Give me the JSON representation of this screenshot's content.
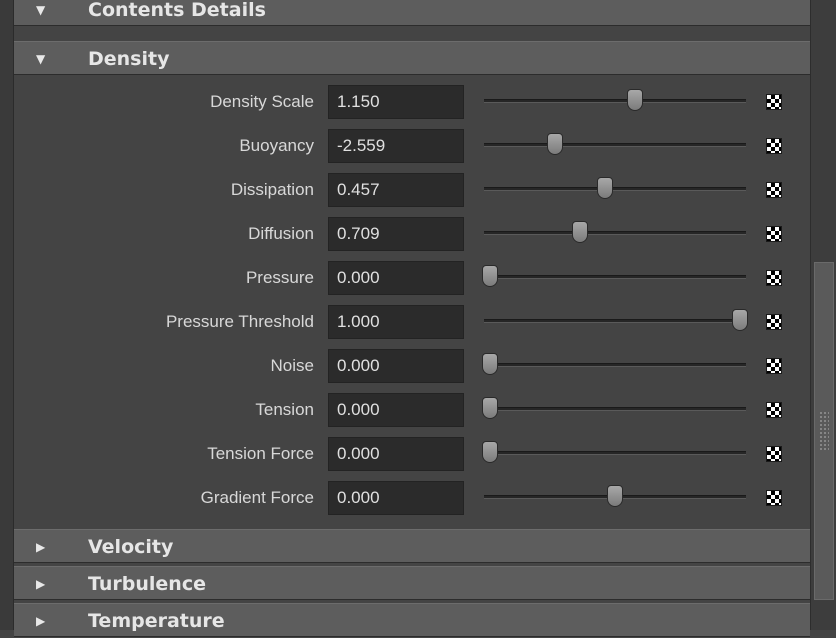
{
  "sections": {
    "contents_details": {
      "title": "Contents Details",
      "arrow": "▼"
    },
    "density": {
      "title": "Density",
      "arrow": "▼"
    },
    "velocity": {
      "title": "Velocity",
      "arrow": "▶"
    },
    "turbulence": {
      "title": "Turbulence",
      "arrow": "▶"
    },
    "temperature": {
      "title": "Temperature",
      "arrow": "▶"
    }
  },
  "density_attributes": [
    {
      "label": "Density Scale",
      "value": "1.150",
      "slider_fraction": 0.58
    },
    {
      "label": "Buoyancy",
      "value": "-2.559",
      "slider_fraction": 0.26
    },
    {
      "label": "Dissipation",
      "value": "0.457",
      "slider_fraction": 0.46
    },
    {
      "label": "Diffusion",
      "value": "0.709",
      "slider_fraction": 0.36
    },
    {
      "label": "Pressure",
      "value": "0.000",
      "slider_fraction": 0.0
    },
    {
      "label": "Pressure Threshold",
      "value": "1.000",
      "slider_fraction": 1.0
    },
    {
      "label": "Noise",
      "value": "0.000",
      "slider_fraction": 0.0
    },
    {
      "label": "Tension",
      "value": "0.000",
      "slider_fraction": 0.0
    },
    {
      "label": "Tension Force",
      "value": "0.000",
      "slider_fraction": 0.0
    },
    {
      "label": "Gradient Force",
      "value": "0.000",
      "slider_fraction": 0.5
    }
  ],
  "icons": {
    "map_button": "checker-map-icon",
    "expanded": "triangle-down-icon",
    "collapsed": "triangle-right-icon"
  }
}
